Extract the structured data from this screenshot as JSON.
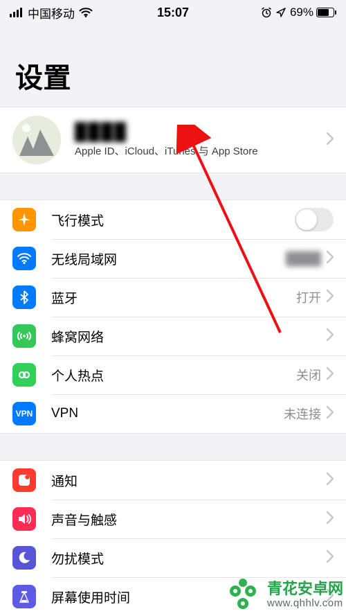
{
  "status": {
    "carrier": "中国移动",
    "time": "15:07",
    "battery_pct": "69%"
  },
  "page": {
    "title": "设置"
  },
  "profile": {
    "name": "████",
    "subtitle": "Apple ID、iCloud、iTunes 与 App Store"
  },
  "group1": {
    "airplane": {
      "label": "飞行模式",
      "on": false
    },
    "wifi": {
      "label": "无线局域网",
      "value": "████"
    },
    "bluetooth": {
      "label": "蓝牙",
      "value": "打开"
    },
    "cellular": {
      "label": "蜂窝网络"
    },
    "hotspot": {
      "label": "个人热点",
      "value": "关闭"
    },
    "vpn": {
      "label": "VPN",
      "value": "未连接",
      "badge": "VPN"
    }
  },
  "group2": {
    "notifications": {
      "label": "通知"
    },
    "sounds": {
      "label": "声音与触感"
    },
    "dnd": {
      "label": "勿扰模式"
    },
    "screentime": {
      "label": "屏幕使用时间"
    }
  },
  "watermark": {
    "title": "青花安卓网",
    "url": "www.qhhlv.com"
  }
}
